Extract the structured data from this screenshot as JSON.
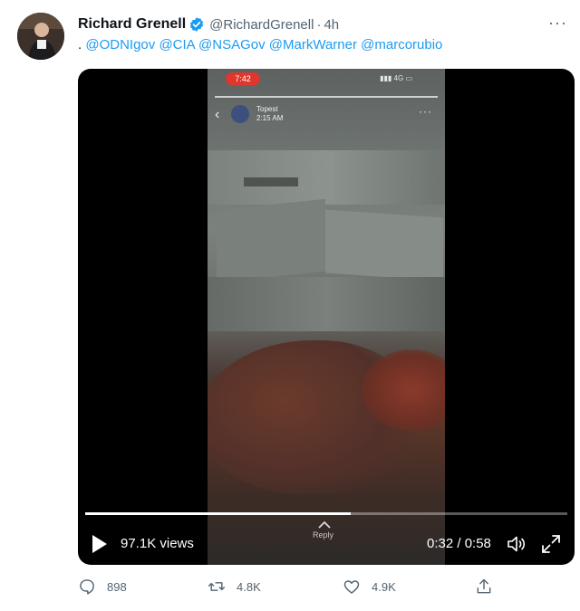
{
  "tweet": {
    "author_name": "Richard Grenell",
    "handle": "@RichardGrenell",
    "separator": "·",
    "time": "4h",
    "text_prefix": ". ",
    "mentions": [
      "@ODNIgov",
      "@CIA",
      "@NSAGov",
      "@MarkWarner",
      "@marcorubio"
    ]
  },
  "video": {
    "views": "97.1K views",
    "time_current": "0:32",
    "time_total": "0:58",
    "time_display": "0:32 / 0:58",
    "progress": 0.55,
    "reply_label": "Reply",
    "embedded_story": {
      "status_time": "7:42",
      "network": "4G",
      "username": "Topest",
      "post_time": "2:15 AM"
    }
  },
  "actions": {
    "replies": "898",
    "retweets": "4.8K",
    "likes": "4.9K"
  },
  "colors": {
    "accent": "#1d9bf0",
    "secondary_text": "#536471",
    "video_bg": "#000000"
  }
}
